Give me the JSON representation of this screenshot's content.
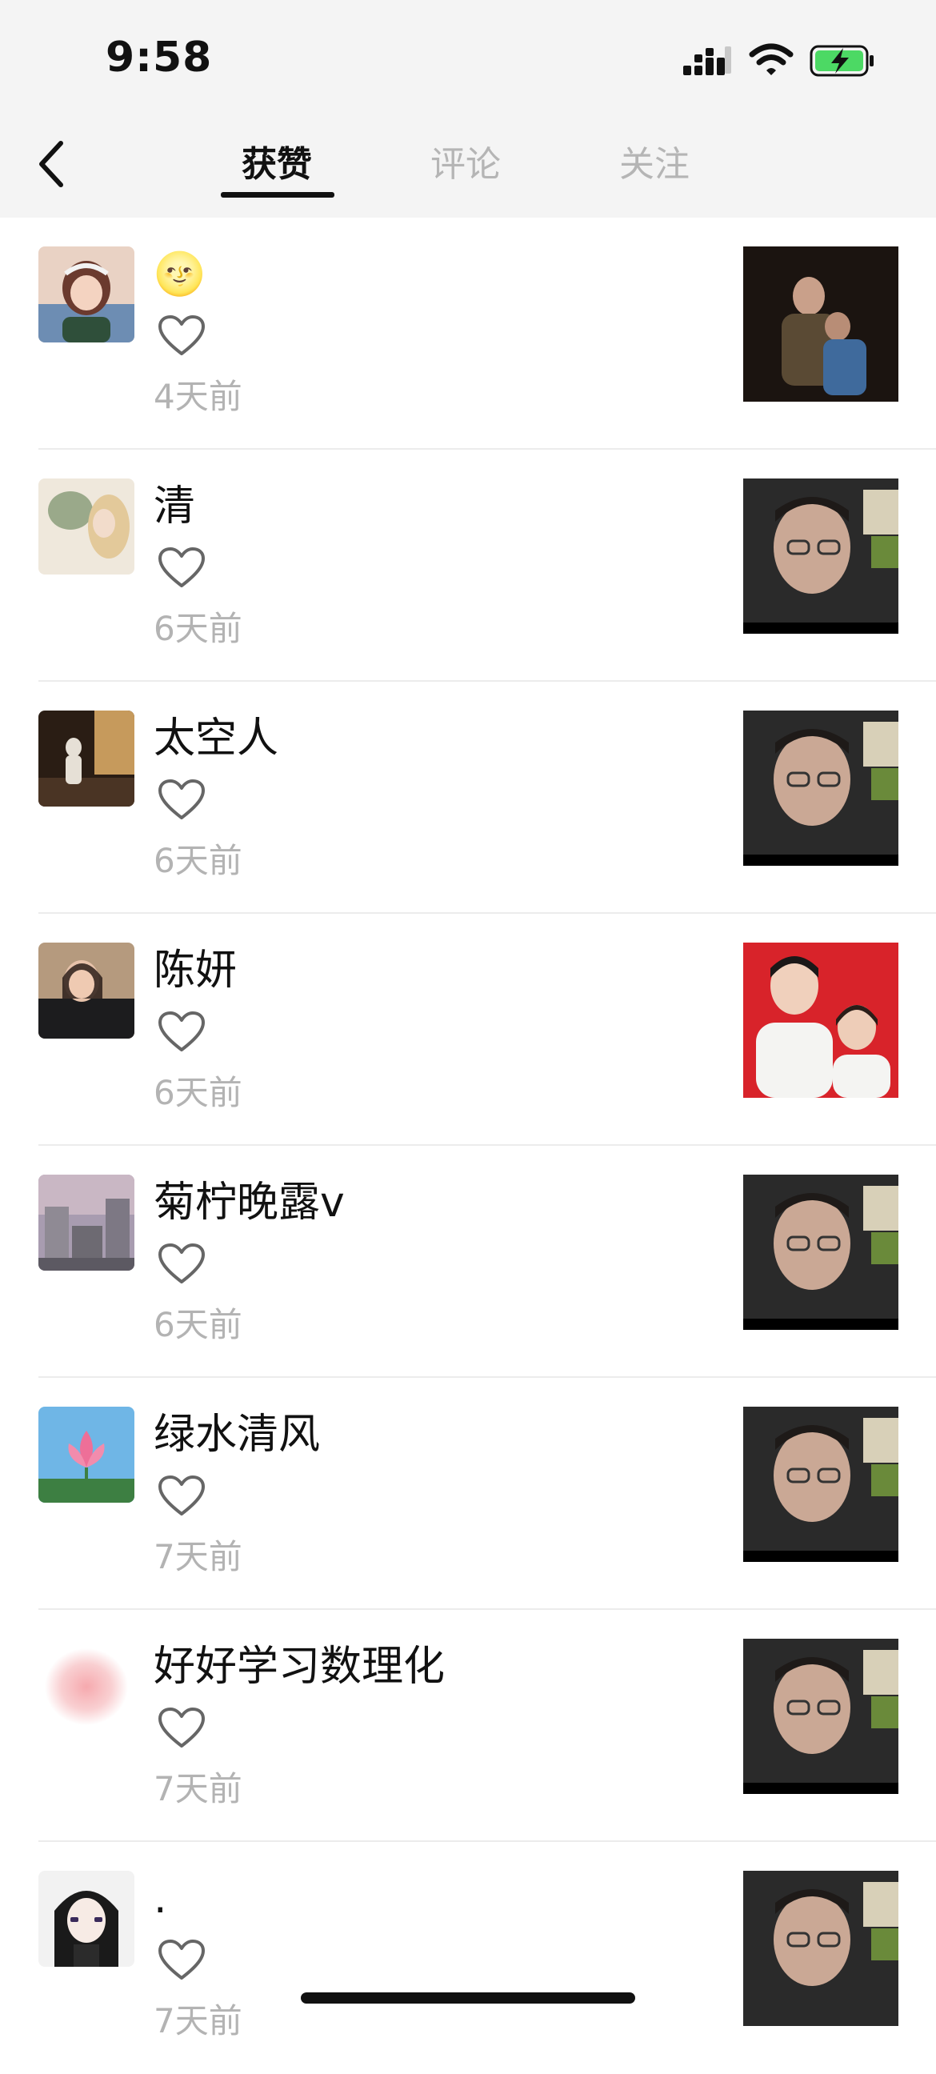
{
  "status_bar": {
    "time": "9:58",
    "icons": [
      "cellular-signal-icon",
      "wifi-icon",
      "battery-charging-icon"
    ]
  },
  "nav": {
    "back_icon": "chevron-left-icon",
    "tabs": [
      {
        "label": "获赞",
        "active": true
      },
      {
        "label": "评论",
        "active": false
      },
      {
        "label": "关注",
        "active": false
      }
    ]
  },
  "colors": {
    "accent": "#111111",
    "inactive_tab": "#b5b5b5",
    "time_text": "#b3b3b3",
    "header_bg": "#f4f4f4"
  },
  "notifications": [
    {
      "name": "🌝",
      "time": "4天前",
      "icon": "heart-outline-icon"
    },
    {
      "name": "清",
      "time": "6天前",
      "icon": "heart-outline-icon"
    },
    {
      "name": "太空人",
      "time": "6天前",
      "icon": "heart-outline-icon"
    },
    {
      "name": "陈妍",
      "time": "6天前",
      "icon": "heart-outline-icon"
    },
    {
      "name": "菊柠晚露v",
      "time": "6天前",
      "icon": "heart-outline-icon"
    },
    {
      "name": "绿水清风",
      "time": "7天前",
      "icon": "heart-outline-icon"
    },
    {
      "name": "好好学习数理化",
      "time": "7天前",
      "icon": "heart-outline-icon"
    },
    {
      "name": ".",
      "time": "7天前",
      "icon": "heart-outline-icon"
    }
  ]
}
